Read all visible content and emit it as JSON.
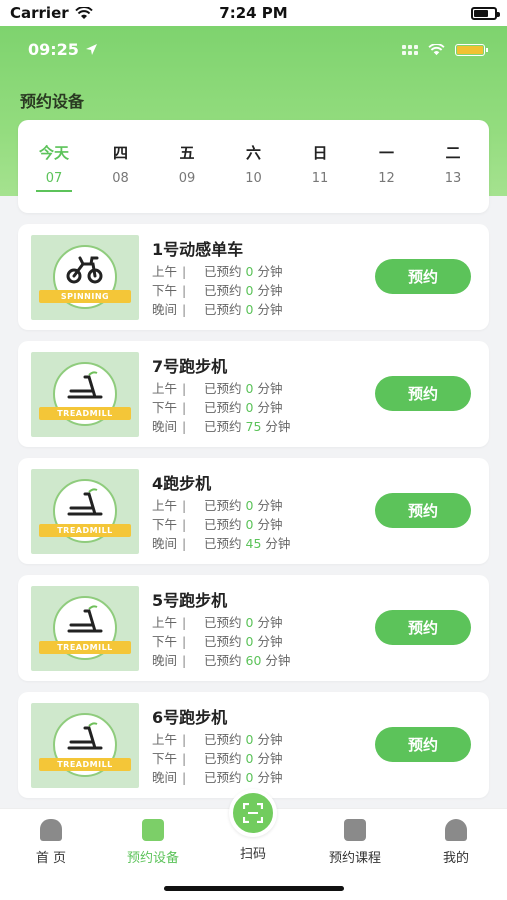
{
  "ios_status": {
    "carrier": "Carrier",
    "time": "7:24 PM"
  },
  "app_status": {
    "time": "09:25"
  },
  "page_title": "预约设备",
  "accent_color": "#5cc35a",
  "dates": [
    {
      "weekday": "今天",
      "day": "07",
      "active": true
    },
    {
      "weekday": "四",
      "day": "08"
    },
    {
      "weekday": "五",
      "day": "09"
    },
    {
      "weekday": "六",
      "day": "10"
    },
    {
      "weekday": "日",
      "day": "11"
    },
    {
      "weekday": "一",
      "day": "12"
    },
    {
      "weekday": "二",
      "day": "13"
    }
  ],
  "periods": {
    "morning": "上午",
    "afternoon": "下午",
    "evening": "晚间",
    "separator": "|",
    "booked": "已预约",
    "unit": "分钟"
  },
  "book_label": "预约",
  "equipment": [
    {
      "name": "1号动感单车",
      "badge": "SPINNING",
      "icon": "bike-icon",
      "morning": "0",
      "afternoon": "0",
      "evening": "0"
    },
    {
      "name": "7号跑步机",
      "badge": "TREADMILL",
      "icon": "treadmill-icon",
      "morning": "0",
      "afternoon": "0",
      "evening": "75"
    },
    {
      "name": "4跑步机",
      "badge": "TREADMILL",
      "icon": "treadmill-icon",
      "morning": "0",
      "afternoon": "0",
      "evening": "45"
    },
    {
      "name": "5号跑步机",
      "badge": "TREADMILL",
      "icon": "treadmill-icon",
      "morning": "0",
      "afternoon": "0",
      "evening": "60"
    },
    {
      "name": "6号跑步机",
      "badge": "TREADMILL",
      "icon": "treadmill-icon",
      "morning": "0",
      "afternoon": "0",
      "evening": "0"
    }
  ],
  "tabs": {
    "home": "首 页",
    "booking": "预约设备",
    "scan": "扫码",
    "courses": "预约课程",
    "mine": "我的"
  }
}
